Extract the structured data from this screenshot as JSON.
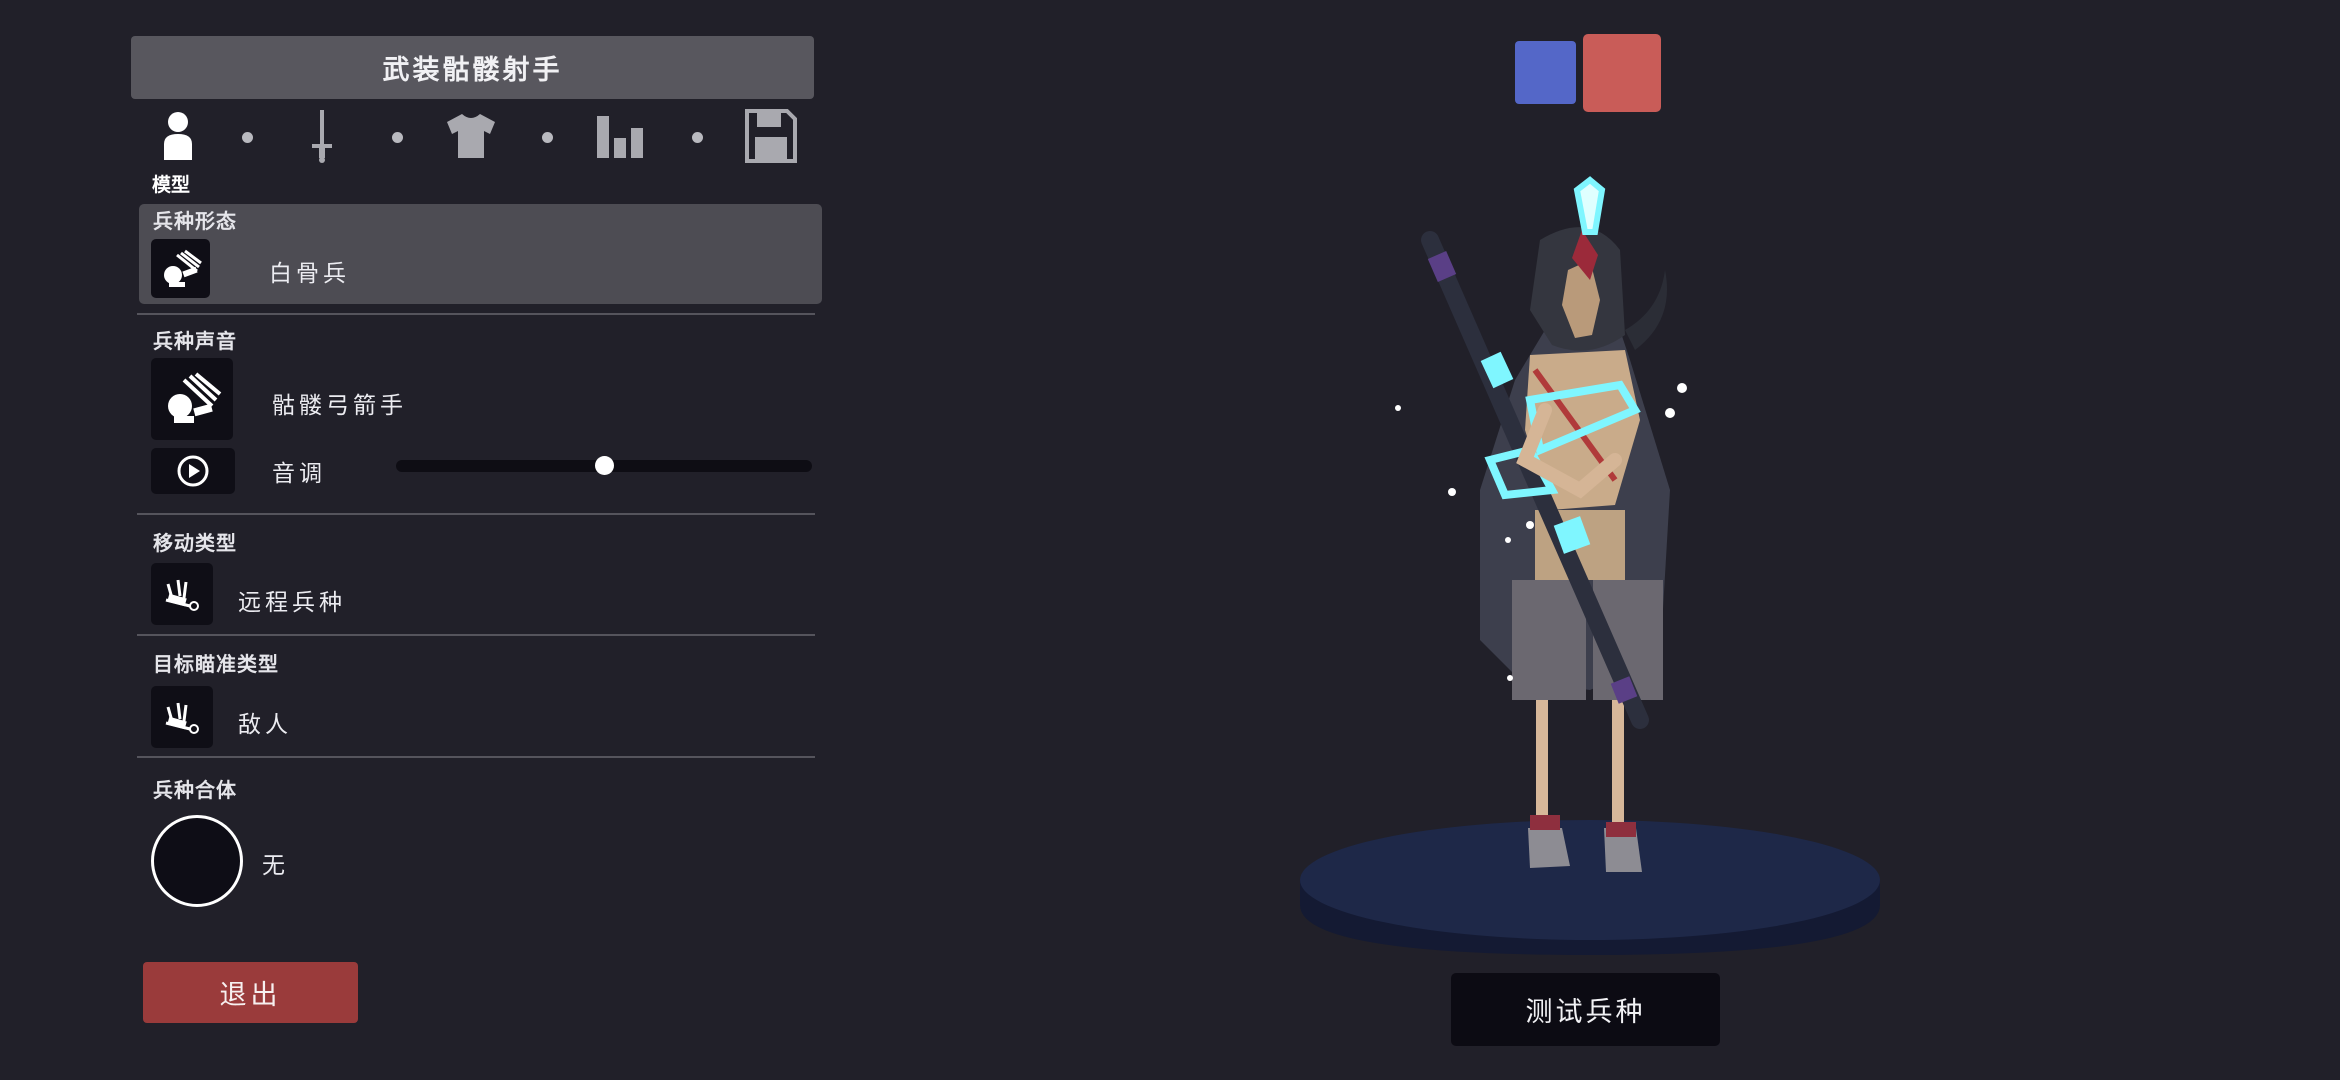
{
  "header": {
    "title": "武装骷髅射手"
  },
  "tabs": [
    {
      "icon": "person-icon",
      "label": "模型",
      "active": true
    },
    {
      "icon": "sword-icon"
    },
    {
      "icon": "shirt-icon"
    },
    {
      "icon": "stats-bars-icon"
    },
    {
      "icon": "save-disk-icon"
    }
  ],
  "unit_form": {
    "title": "兵种形态",
    "value": "白骨兵"
  },
  "unit_voice": {
    "title": "兵种声音",
    "value": "骷髅弓箭手",
    "pitch_label": "音调",
    "pitch_value": 0.5
  },
  "movement": {
    "title": "移动类型",
    "value": "远程兵种"
  },
  "targeting": {
    "title": "目标瞄准类型",
    "value": "敌人"
  },
  "combine": {
    "title": "兵种合体",
    "value": "无"
  },
  "buttons": {
    "exit": "退出",
    "test": "测试兵种"
  },
  "team_colors": {
    "blue": "#5467c8",
    "red": "#c95c58"
  },
  "colors": {
    "background": "#212029",
    "panel": "#58575e",
    "exit": "#9a3b3b",
    "glow": "#7ff6ff"
  }
}
